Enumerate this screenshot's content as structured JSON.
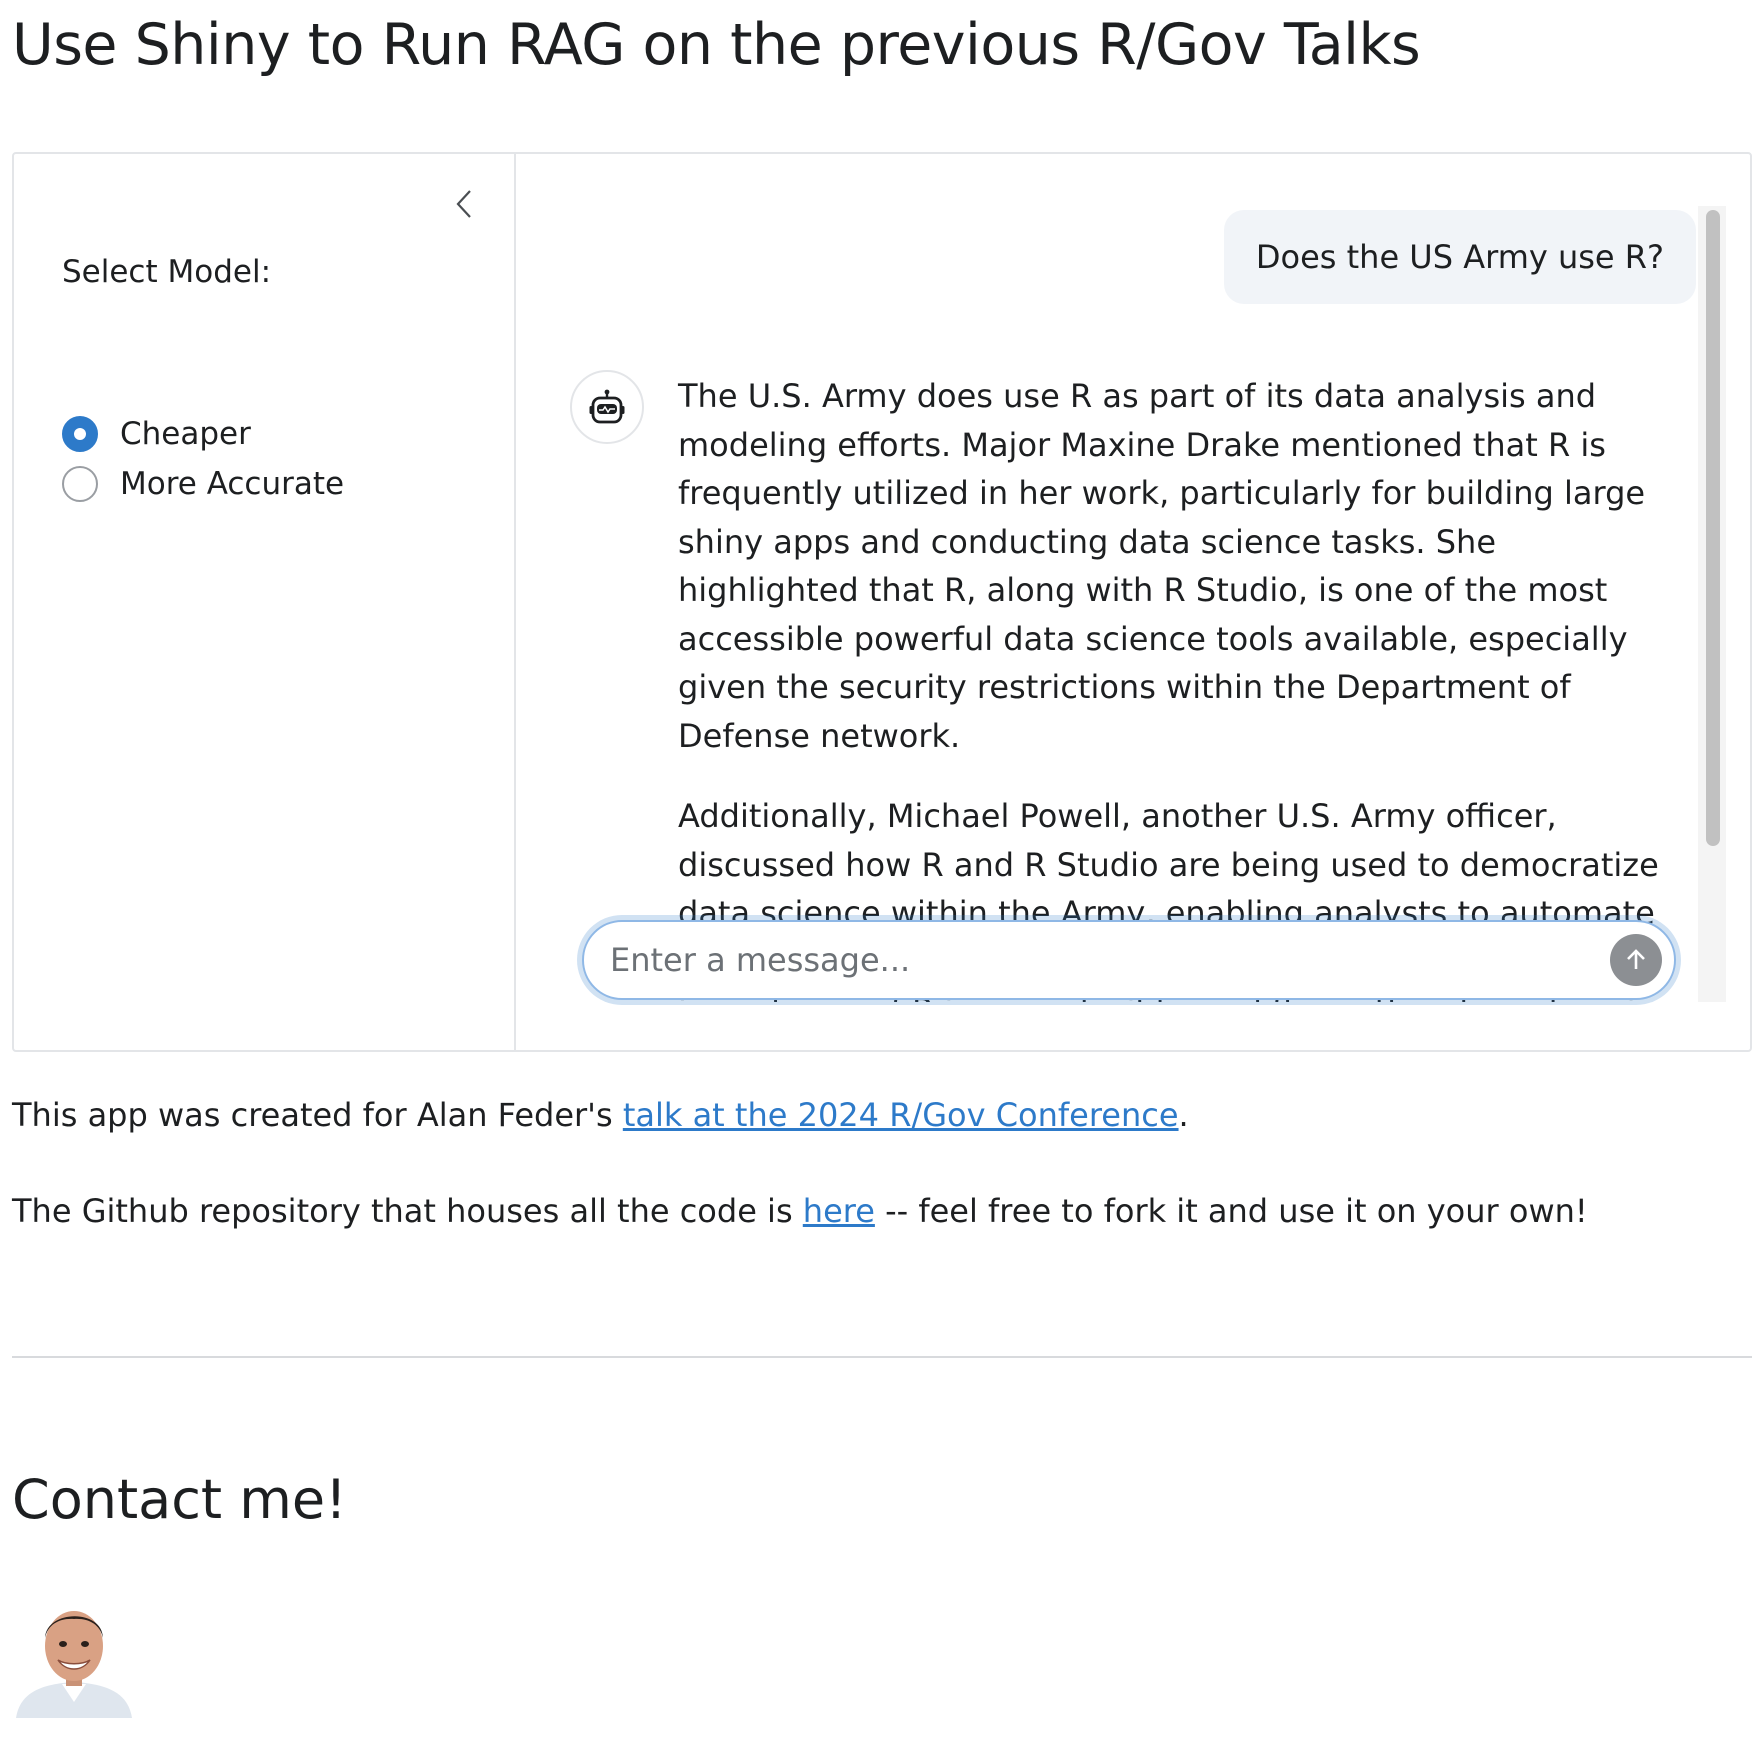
{
  "page": {
    "title": "Use Shiny to Run RAG on the previous R/Gov Talks"
  },
  "sidebar": {
    "label": "Select Model:",
    "options": [
      {
        "label": "Cheaper",
        "checked": true
      },
      {
        "label": "More Accurate",
        "checked": false
      }
    ],
    "collapse_icon": "chevron-left-icon"
  },
  "chat": {
    "user_message": "Does the US Army use R?",
    "assistant_paragraphs": [
      "The U.S. Army does use R as part of its data analysis and modeling efforts. Major Maxine Drake mentioned that R is frequently utilized in her work, particularly for building large shiny apps and conducting data science tasks. She highlighted that R, along with R Studio, is one of the most accessible powerful data science tools available, especially given the security restrictions within the Department of Defense network.",
      "Additionally, Michael Powell, another U.S. Army officer, discussed how R and R Studio are being used to democratize data science within the Army, enabling analysts to automate tedious processes and develop workflows. He emphasized the importance of R in reproducible workflows, thereby enhancing the data literacy of"
    ],
    "input_placeholder": "Enter a message...",
    "input_value": "",
    "send_icon": "arrow-up-icon",
    "avatar_icon": "robot-icon"
  },
  "info": {
    "line1_prefix": "This app was created for Alan Feder's ",
    "line1_link": "talk at the 2024 R/Gov Conference",
    "line1_suffix": ".",
    "line2_prefix": "The Github repository that houses all the code is ",
    "line2_link": "here",
    "line2_suffix": " -- feel free to fork it and use it on your own!"
  },
  "contact": {
    "heading": "Contact me!"
  },
  "colors": {
    "accent": "#2d7ac9",
    "user_bubble_bg": "#f1f4f8",
    "border": "#e3e5e8",
    "send_button": "#8c8f93"
  }
}
